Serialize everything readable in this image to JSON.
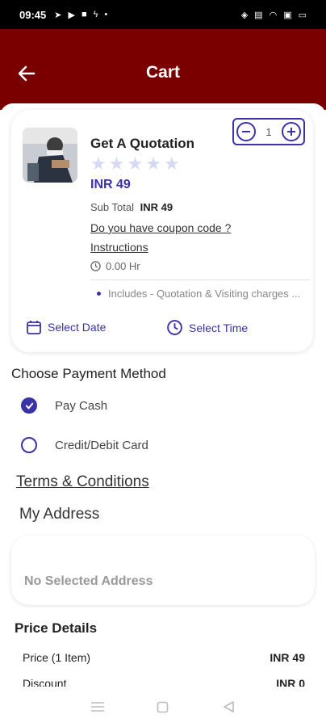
{
  "status_bar": {
    "time": "09:45"
  },
  "header": {
    "title": "Cart"
  },
  "cart_item": {
    "title": "Get A Quotation",
    "quantity": "1",
    "rating_stars": 5,
    "price": "INR 49",
    "subtotal_label": "Sub Total",
    "subtotal_value": "INR 49",
    "coupon_link": "Do you have coupon code ?",
    "instructions_link": "Instructions",
    "duration": "0.00 Hr",
    "includes": "Includes - Quotation & Visiting charges ...",
    "select_date_label": "Select Date",
    "select_time_label": "Select Time"
  },
  "payment": {
    "title": "Choose Payment Method",
    "options": [
      {
        "label": "Pay Cash",
        "selected": true
      },
      {
        "label": "Credit/Debit Card",
        "selected": false
      }
    ]
  },
  "terms": {
    "label": "Terms & Conditions"
  },
  "address": {
    "title": "My Address",
    "empty_text": "No Selected Address"
  },
  "price_details": {
    "title": "Price Details",
    "rows": [
      {
        "label": "Price (1 Item)",
        "value": "INR 49"
      },
      {
        "label": "Discount",
        "value": "INR 0"
      }
    ]
  },
  "colors": {
    "header_bg": "#7a0000",
    "accent": "#3a33a8"
  },
  "icons": {
    "back": "arrow-left-icon",
    "minus": "minus-icon",
    "plus": "plus-icon",
    "clock": "clock-icon",
    "calendar": "calendar-icon",
    "check": "check-icon",
    "nav_menu": "menu-icon",
    "nav_home": "square-icon",
    "nav_back": "triangle-back-icon"
  }
}
